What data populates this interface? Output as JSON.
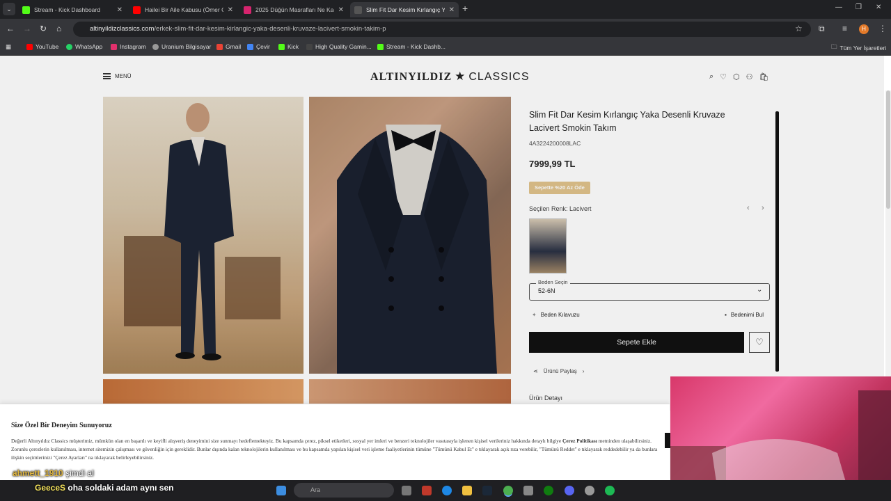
{
  "browser": {
    "tabs": [
      {
        "title": "Stream - Kick Dashboard",
        "favicon_color": "#53fc18",
        "active": false
      },
      {
        "title": "Hailei Bir Aile Kabusu (Ömer Gü",
        "favicon_color": "#ff0000",
        "active": false
      },
      {
        "title": "2025 Düğün Masrafları Ne Kad",
        "favicon_color": "#d6246e",
        "active": false
      },
      {
        "title": "Slim Fit Dar Kesim Kırlangıç Yak",
        "favicon_color": "#333333",
        "active": true
      }
    ],
    "url_domain": "altinyildizclassics.com",
    "url_path": "/erkek-slim-fit-dar-kesim-kirlangic-yaka-desenli-kruvaze-lacivert-smokin-takim-p",
    "bookmarks": [
      {
        "label": "YouTube",
        "color": "#ff0000"
      },
      {
        "label": "WhatsApp",
        "color": "#25d366"
      },
      {
        "label": "Instagram",
        "color": "#e1306c"
      },
      {
        "label": "Uranium Bilgisayar",
        "color": "#999999"
      },
      {
        "label": "Gmail",
        "color": "#ea4335"
      },
      {
        "label": "Çevir",
        "color": "#4285f4"
      },
      {
        "label": "Kick",
        "color": "#53fc18"
      },
      {
        "label": "High Quality Gamin...",
        "color": "#444444"
      },
      {
        "label": "Stream - Kick Dashb...",
        "color": "#53fc18"
      }
    ],
    "all_bookmarks": "Tüm Yer İşaretleri",
    "profile_initial": "H"
  },
  "site": {
    "menu_label": "MENÜ",
    "logo_bold": "ALTINYILDIZ",
    "logo_light": "CLASSICS"
  },
  "product": {
    "title": "Slim Fit Dar Kesim Kırlangıç Yaka Desenli Kruvaze Lacivert Smokin Takım",
    "sku": "4A3224200008LAC",
    "price": "7999,99 TL",
    "promo": "Sepette %20 Az Öde",
    "selected_color": "Seçilen Renk: Lacivert",
    "size_label": "Beden Seçin",
    "size_value": "52-6N",
    "size_guide": "Beden Kılavuzu",
    "find_size": "Bedenimi Bul",
    "add_to_cart": "Sepete Ekle",
    "share": "Ürünü Paylaş",
    "details": "Ürün Detayı"
  },
  "cookie": {
    "title": "Size Özel Bir Deneyim Sunuyoruz",
    "text_a": "Değerli Altınyıldız Classics müşterimiz, mümkün olan en başarılı ve keyifli alışveriş deneyimini size sunmayı hedeflemekteyiz. Bu kapsamda çerez, piksel etiketleri, sosyal yer imleri ve benzeri teknolojiler vasıtasıyla işlenen kişisel verileriniz hakkında detaylı bilgiye",
    "policy": "Çerez Politikası",
    "text_b": "metninden ulaşabilirsiniz. Zorunlu çerezlerin kullanılması, internet sitemizin çalışması ve güvenliğin için gereklidir. Bunlar dışında kalan teknolojilerin kullanılması ve bu kapsamda yapılan kişisel veri işleme faaliyetlerinin tümüne \"Tümünü Kabul Et\" e tıklayarak açık rıza verebilir, \"Tümünü Reddet\" e tıklayarak reddedebilir ya da bunlara ilişkin seçimlerinizi \"Çerez Ayarları\" na tıklayarak belirleyebilirsiniz."
  },
  "chat": [
    {
      "user": "ahmett_1910",
      "message": "şimdi al"
    },
    {
      "user": "GeeceS",
      "message": "oha soldaki adam aynı sen"
    }
  ],
  "taskbar": {
    "search_placeholder": "Ara"
  }
}
